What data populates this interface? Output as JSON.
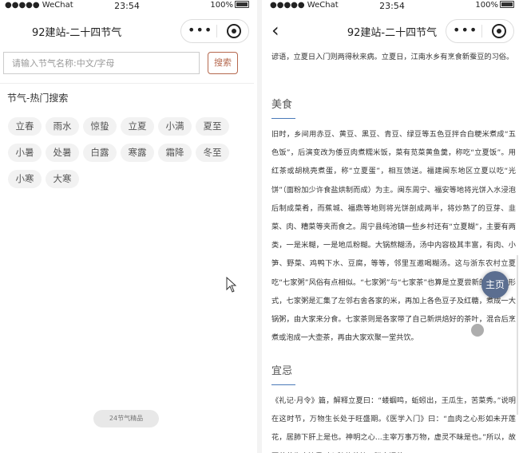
{
  "status": {
    "carrier": "●●●●● WeChat",
    "time": "23:54",
    "battery": "100%"
  },
  "navbar": {
    "title": "92建站-二十四节气",
    "more_icon": "•••",
    "back_icon": "‹"
  },
  "left": {
    "search": {
      "placeholder": "请输入节气名称:中文/字母",
      "button_label": "搜索"
    },
    "hot_title": "节气-热门搜索",
    "tags": [
      "立春",
      "雨水",
      "惊蛰",
      "立夏",
      "小满",
      "夏至",
      "小暑",
      "处暑",
      "白露",
      "寒露",
      "霜降",
      "冬至",
      "小寒",
      "大寒"
    ],
    "bottom_pill": "24节气精品"
  },
  "right": {
    "intro_para": "谚语，立夏日入门则两得秋来病。立夏日，江南水乡有烹食新蚕豆的习俗。",
    "sections": [
      {
        "title": "美食",
        "text": "旧时，乡间用赤豆、黄豆、黑豆、青豆、绿豆等五色豆拌合白粳米煮成“五色饭”，后演变改为倭豆肉煮糯米饭，菜有苋菜黄鱼羹，称吃“立夏饭”。用红茶或胡桃壳煮蛋，称“立夏蛋”，相互馈送。福建闽东地区立夏以吃“光饼”（面粉加少许食盐烘制而成）为主。闽东周宁、福安等地将光饼入水浸泡后制成菜肴，而蕉城、福鼎等地则将光饼剖成两半，将炒熟了的豆芽、韭菜、肉、糟菜等夹而食之。周宁县纯池镇一些乡村还有“立夏糊”，主要有两类，一是米糊，一是地瓜粉糊。大锅熬糊汤，汤中内容极其丰富，有肉、小笋、野菜、鸡鸭下水、豆腐，等等，邻里互邀喝糊汤。这与浙东农村立夏吃“七家粥”风俗有点相似。“七家粥”与“七家茶”也算是立夏尝新的又一种形式，七家粥是汇集了左邻右舍各家的米，再加上各色豆子及红糖，煮成一大锅粥，由大家来分食。七家茶则是各家带了自己新烘焙好的茶叶，混合后烹煮或泡成一大壶茶，再由大家欢聚一堂共饮。"
      },
      {
        "title": "宜忌",
        "text": "《礼记·月令》篇，解释立夏曰：“蝼蝈鸣，蚯蚓出，王瓜生，苦菜秀。”说明在这时节，万物生长处于旺盛期。《医学入门》曰：“血肉之心形如未开莲花，居肺下肝上是也。神明之心...主宰万事万物，虚灵不昧是也。”所以，故夏养养生应注重对心脏的养护。膳食调养"
      }
    ],
    "home_button": "主页"
  },
  "colors": {
    "accent": "#b5684e",
    "underline": "#4a7ab8",
    "home_button": "#5b6e90"
  }
}
